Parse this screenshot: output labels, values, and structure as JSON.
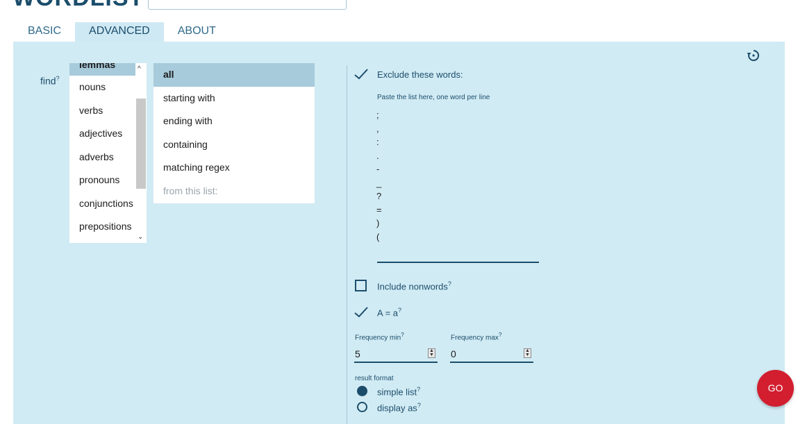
{
  "header": {
    "title": "WORDLIST"
  },
  "tabs": [
    {
      "label": "BASIC",
      "active": false
    },
    {
      "label": "ADVANCED",
      "active": true
    },
    {
      "label": "ABOUT",
      "active": false
    }
  ],
  "find": {
    "label": "find",
    "help": "?"
  },
  "list1": {
    "items": [
      "lemmas",
      "nouns",
      "verbs",
      "adjectives",
      "adverbs",
      "pronouns",
      "conjunctions",
      "prepositions"
    ],
    "selected": "lemmas"
  },
  "list2": {
    "items": [
      "all",
      "starting with",
      "ending with",
      "containing",
      "matching regex",
      "from this list:"
    ],
    "selected": "all"
  },
  "exclude": {
    "checked": true,
    "label": "Exclude these words:",
    "hint": "Paste the list here, one word per line",
    "words": [
      ";",
      ",",
      ":",
      ".",
      "-",
      "_",
      "?",
      "=",
      ")",
      "("
    ]
  },
  "include_nonwords": {
    "checked": false,
    "label": "Include nonwords",
    "help": "?"
  },
  "case_insensitive": {
    "checked": true,
    "label": "A = a",
    "help": "?"
  },
  "frequency": {
    "min_label": "Frequency min",
    "min_value": "5",
    "max_label": "Frequency max",
    "max_value": "0",
    "help": "?"
  },
  "result_format": {
    "label": "result format",
    "options": [
      {
        "label": "simple list",
        "help": "?",
        "selected": true
      },
      {
        "label": "display as",
        "help": "?",
        "selected": false
      }
    ]
  },
  "go_button": {
    "label": "GO"
  },
  "colors": {
    "panel": "#d1ebf4",
    "accent": "#1b4d6b",
    "go": "#d21e2f",
    "selection": "#a7cbdb"
  },
  "icons": {
    "reset": "reset-history-icon",
    "check": "checkmark-icon"
  }
}
